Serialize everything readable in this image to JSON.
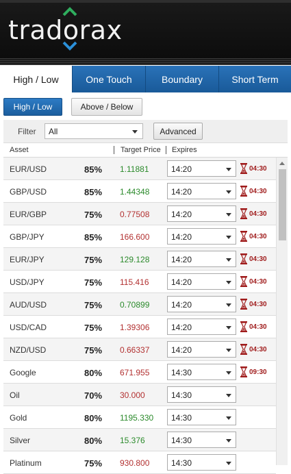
{
  "app": {
    "logo_text": "tradorax"
  },
  "tabs": [
    {
      "label": "High / Low",
      "active": true
    },
    {
      "label": "One Touch",
      "active": false
    },
    {
      "label": "Boundary",
      "active": false
    },
    {
      "label": "Short Term",
      "active": false
    }
  ],
  "subtabs": [
    {
      "label": "High / Low",
      "active": true
    },
    {
      "label": "Above / Below",
      "active": false
    }
  ],
  "filter": {
    "label": "Filter",
    "value": "All",
    "advanced_label": "Advanced"
  },
  "columns": {
    "asset": "Asset",
    "target_price": "Target Price",
    "expires": "Expires"
  },
  "colors": {
    "price_up": "#2b8a2b",
    "price_down": "#b23030",
    "countdown": "#a01d1d",
    "tab_blue": "#1f5f9f"
  },
  "rows": [
    {
      "asset": "EUR/USD",
      "payout": "85%",
      "price": "1.11881",
      "trend": "up",
      "expires": "14:20",
      "countdown": "04:30"
    },
    {
      "asset": "GBP/USD",
      "payout": "85%",
      "price": "1.44348",
      "trend": "up",
      "expires": "14:20",
      "countdown": "04:30"
    },
    {
      "asset": "EUR/GBP",
      "payout": "75%",
      "price": "0.77508",
      "trend": "down",
      "expires": "14:20",
      "countdown": "04:30"
    },
    {
      "asset": "GBP/JPY",
      "payout": "85%",
      "price": "166.600",
      "trend": "down",
      "expires": "14:20",
      "countdown": "04:30"
    },
    {
      "asset": "EUR/JPY",
      "payout": "75%",
      "price": "129.128",
      "trend": "up",
      "expires": "14:20",
      "countdown": "04:30"
    },
    {
      "asset": "USD/JPY",
      "payout": "75%",
      "price": "115.416",
      "trend": "down",
      "expires": "14:20",
      "countdown": "04:30"
    },
    {
      "asset": "AUD/USD",
      "payout": "75%",
      "price": "0.70899",
      "trend": "up",
      "expires": "14:20",
      "countdown": "04:30"
    },
    {
      "asset": "USD/CAD",
      "payout": "75%",
      "price": "1.39306",
      "trend": "down",
      "expires": "14:20",
      "countdown": "04:30"
    },
    {
      "asset": "NZD/USD",
      "payout": "75%",
      "price": "0.66337",
      "trend": "down",
      "expires": "14:20",
      "countdown": "04:30"
    },
    {
      "asset": "Google",
      "payout": "80%",
      "price": "671.955",
      "trend": "down",
      "expires": "14:30",
      "countdown": "09:30"
    },
    {
      "asset": "Oil",
      "payout": "70%",
      "price": "30.000",
      "trend": "down",
      "expires": "14:30",
      "countdown": ""
    },
    {
      "asset": "Gold",
      "payout": "80%",
      "price": "1195.330",
      "trend": "up",
      "expires": "14:30",
      "countdown": ""
    },
    {
      "asset": "Silver",
      "payout": "80%",
      "price": "15.376",
      "trend": "up",
      "expires": "14:30",
      "countdown": ""
    },
    {
      "asset": "Platinum",
      "payout": "75%",
      "price": "930.800",
      "trend": "down",
      "expires": "14:30",
      "countdown": ""
    }
  ]
}
